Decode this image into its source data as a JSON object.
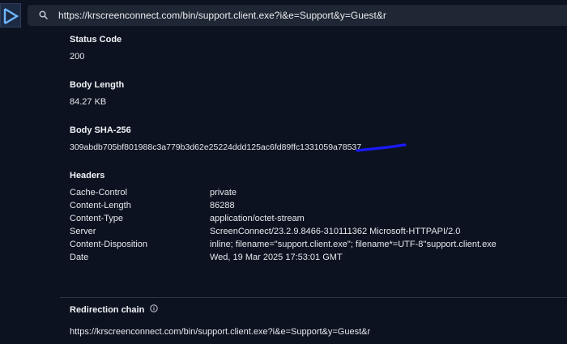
{
  "address_bar": {
    "url": "https://krscreenconnect.com/bin/support.client.exe?i&e=Support&y=Guest&r",
    "search_icon": "search-icon",
    "logo_icon": "chevron-logo-icon"
  },
  "status": {
    "label": "Status Code",
    "value": "200"
  },
  "body_length": {
    "label": "Body Length",
    "value": "84.27 KB"
  },
  "body_sha": {
    "label": "Body SHA-256",
    "value": "309abdb705bf801988c3a779b3d62e25224ddd125ac6fd89ffc1331059a78537"
  },
  "headers": {
    "label": "Headers",
    "rows": [
      {
        "key": "Cache-Control",
        "value": "private"
      },
      {
        "key": "Content-Length",
        "value": "86288"
      },
      {
        "key": "Content-Type",
        "value": "application/octet-stream"
      },
      {
        "key": "Server",
        "value": "ScreenConnect/23.2.9.8466-310111362 Microsoft-HTTPAPI/2.0"
      },
      {
        "key": "Content-Disposition",
        "value": "inline; filename=\"support.client.exe\"; filename*=UTF-8''support.client.exe"
      },
      {
        "key": "Date",
        "value": "Wed, 19 Mar 2025 17:53:01 GMT"
      }
    ]
  },
  "redirection": {
    "label": "Redirection chain",
    "info_icon": "info-icon",
    "url": "https://krscreenconnect.com/bin/support.client.exe?i&e=Support&y=Guest&r"
  },
  "colors": {
    "background": "#0c1220",
    "url_bar": "#1f2634",
    "annotation_stroke": "#1a1aff"
  }
}
